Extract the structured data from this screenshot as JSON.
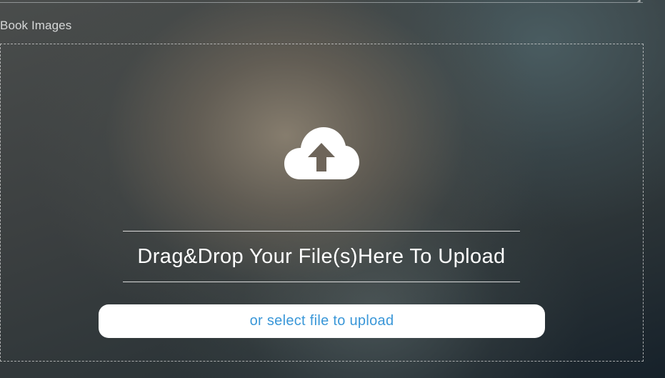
{
  "section": {
    "label": "Book Images"
  },
  "dropzone": {
    "icon": "cloud-upload-icon",
    "instruction": "Drag&Drop Your File(s)Here To Upload",
    "select_label": "or select file to upload"
  },
  "colors": {
    "link_blue": "#3a97d8",
    "button_bg": "#ffffff",
    "icon_fill": "#ffffff",
    "arrow_fill": "#6e655a"
  }
}
